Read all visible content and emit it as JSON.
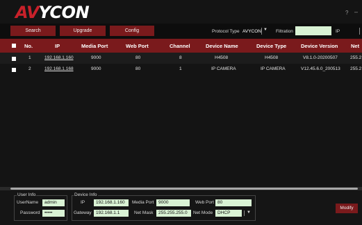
{
  "app": {
    "logo_accent": "AV",
    "logo_rest": "YCON",
    "help_icon": "?",
    "minimize_icon": "–"
  },
  "toolbar": {
    "search_label": "Search",
    "upgrade_label": "Upgrade",
    "config_label": "Config",
    "protocol_type_label": "Protocol Type",
    "protocol_type_value": "AVYCON",
    "filtration_label": "Filtration",
    "filtration_value": "",
    "filtration_suffix": "IP"
  },
  "table": {
    "columns": [
      "No.",
      "IP",
      "Media Port",
      "Web Port",
      "Channel",
      "Device Name",
      "Device Type",
      "Device Version",
      "Net"
    ],
    "rows": [
      {
        "no": "1",
        "ip": "192.168.1.160",
        "media_port": "9000",
        "web_port": "80",
        "channel": "8",
        "device_name": "H4508",
        "device_type": "H4508",
        "device_version": "V8.1.0-20200507",
        "net": "255.2"
      },
      {
        "no": "2",
        "ip": "192.168.1.168",
        "media_port": "9000",
        "web_port": "80",
        "channel": "1",
        "device_name": "IP CAMERA",
        "device_type": "IP CAMERA",
        "device_version": "V12.45.6.0_200513",
        "net": "255.2"
      }
    ]
  },
  "user_info": {
    "title": "User Info",
    "username_label": "UserName",
    "username_value": "admin",
    "password_label": "Password",
    "password_value": "•••••"
  },
  "device_info": {
    "title": "Device Info",
    "ip_label": "IP",
    "ip_value": "192.168.1.160",
    "media_port_label": "Media Port",
    "media_port_value": "9000",
    "web_port_label": "Web Port",
    "web_port_value": "80",
    "gateway_label": "Gateway",
    "gateway_value": "192.168.1.1",
    "netmask_label": "Net Mask",
    "netmask_value": "255.255.255.0",
    "netmode_label": "Net Mode",
    "netmode_value": "DHCP"
  },
  "actions": {
    "modify_label": "Modify"
  },
  "colors": {
    "accent": "#7a1a1c",
    "logo_red": "#c8212a",
    "input_bg": "#d9f2d4",
    "background": "#111111"
  }
}
